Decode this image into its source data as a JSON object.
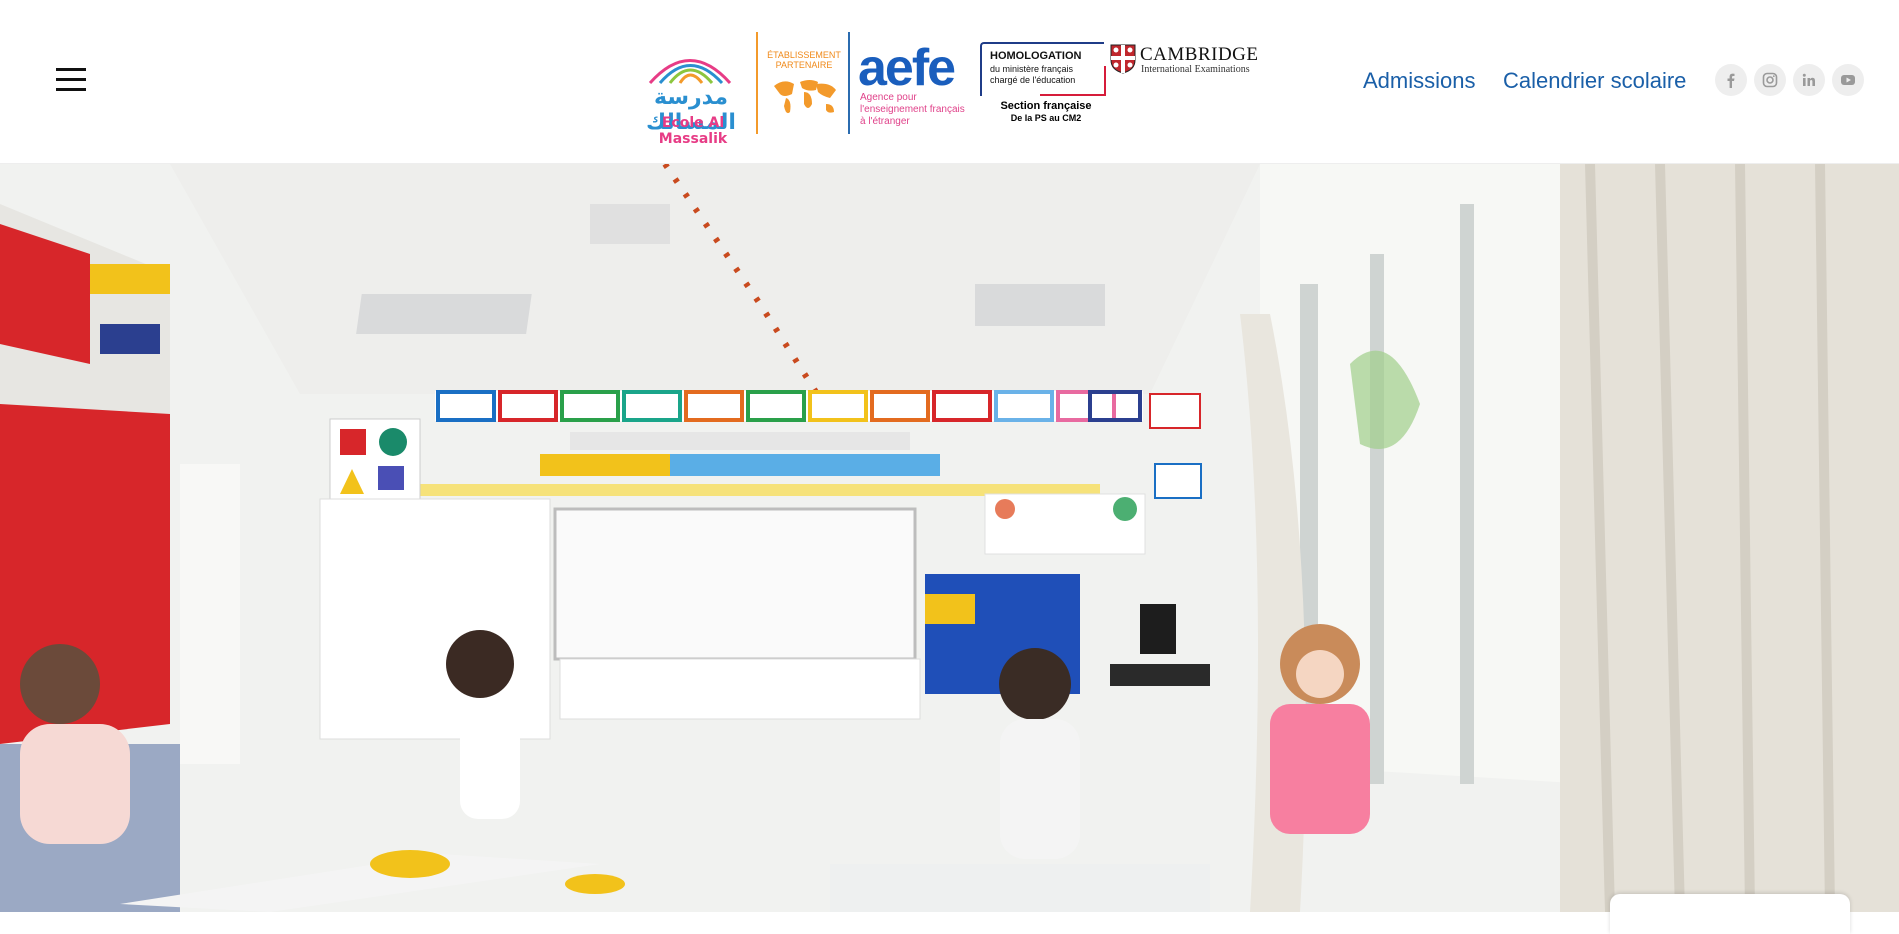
{
  "header": {
    "menu_icon": "hamburger-menu-icon",
    "logos": {
      "massalik_arabic": "مدرسة المسالك",
      "massalik_name": "Ecole Al Massalik",
      "partner_label": "ÉTABLISSEMENT PARTENAIRE",
      "aefe_mark": "aefe",
      "aefe_tagline_1": "Agence pour",
      "aefe_tagline_2": "l'enseignement français",
      "aefe_tagline_3": "à l'étranger",
      "homologation_title": "HOMOLOGATION",
      "homologation_line1": "du ministère français",
      "homologation_line2": "chargé de l'éducation",
      "section_title": "Section française",
      "section_range": "De la PS au CM2",
      "cambridge_title": "CAMBRIDGE",
      "cambridge_sub": "International Examinations"
    },
    "nav": {
      "admissions": "Admissions",
      "calendrier": "Calendrier scolaire"
    },
    "social": [
      {
        "icon": "facebook-icon"
      },
      {
        "icon": "instagram-icon"
      },
      {
        "icon": "linkedin-icon"
      },
      {
        "icon": "youtube-icon"
      }
    ]
  },
  "hero": {
    "image_description_icon": "classroom-photo",
    "colors": {
      "wall": "#f3f4f2",
      "cabinet_red": "#d7262a",
      "curtain": "#e9e5dc",
      "whiteboard": "#f8f8f8"
    }
  }
}
